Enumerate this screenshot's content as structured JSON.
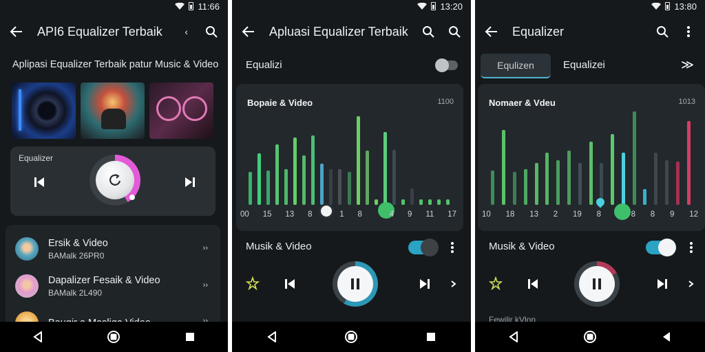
{
  "panel1": {
    "status_time": "11:66",
    "title": "API6 Equalizer Terbaik",
    "title_suffix": "‹",
    "subtitle": "Aplipasi Equalizer Terbaik patur Music & Video",
    "eq_card_label": "Equalizer",
    "list": [
      {
        "title": "Ersik & Video",
        "sub": "BAMalk 26PR0"
      },
      {
        "title": "Dapalizer Fesaik & Video",
        "sub": "BAMalk 2L490"
      },
      {
        "title": "Bougir a Masliga Video",
        "sub": ""
      }
    ],
    "list_arrow": "››"
  },
  "panel2": {
    "status_time": "13:20",
    "title": "Apluasi Equalizer Terbaik",
    "toggle_label": "Equalizi",
    "eq_title": "Bopaie & Video",
    "eq_value": "1100",
    "ticks": [
      "00",
      "15",
      "13",
      "8",
      "",
      "1",
      "8",
      "",
      "4",
      "9",
      "11",
      "17"
    ],
    "bars": [
      {
        "h": 0.35,
        "c": "#39b36a"
      },
      {
        "h": 0.55,
        "c": "#3fcf7c"
      },
      {
        "h": 0.37,
        "c": "#3aa66a"
      },
      {
        "h": 0.65,
        "c": "#57c46f"
      },
      {
        "h": 0.38,
        "c": "#4fb86c"
      },
      {
        "h": 0.72,
        "c": "#63cf69"
      },
      {
        "h": 0.53,
        "c": "#57b86a"
      },
      {
        "h": 0.74,
        "c": "#4bbf77"
      },
      {
        "h": 0.44,
        "c": "#4aa3c8"
      },
      {
        "h": 0.38,
        "c": "#384046"
      },
      {
        "h": 0.38,
        "c": "#4a5056"
      },
      {
        "h": 0.35,
        "c": "#3a7a55"
      },
      {
        "h": 0.95,
        "c": "#6ccf63"
      },
      {
        "h": 0.58,
        "c": "#5ea862"
      },
      {
        "h": 0.06,
        "c": "#6ccf63"
      },
      {
        "h": 0.78,
        "c": "#5ccd7e"
      },
      {
        "h": 0.59,
        "c": "#3b4a55"
      },
      {
        "h": 0.06,
        "c": "#52c46a"
      },
      {
        "h": 0.18,
        "c": "#3a4046"
      },
      {
        "h": 0.06,
        "c": "#52c46a"
      },
      {
        "h": 0.06,
        "c": "#52c46a"
      },
      {
        "h": 0.06,
        "c": "#52c46a"
      },
      {
        "h": 0.06,
        "c": "#52c46a"
      }
    ],
    "track_label": "Musik & Video"
  },
  "panel3": {
    "status_time": "13:80",
    "title": "Equalizer",
    "tab_active": "Equlizen",
    "tab_2": "Equalizei",
    "tab_more": "≫",
    "eq_title": "Nomaer & Vdeu",
    "eq_value": "1013",
    "ticks": [
      "10",
      "18",
      "13",
      "2",
      "19",
      "8",
      "",
      "8",
      "8",
      "9",
      "12"
    ],
    "bars": [
      {
        "h": 0.37,
        "c": "#3c8f55"
      },
      {
        "h": 0.8,
        "c": "#5cc26a"
      },
      {
        "h": 0.35,
        "c": "#3d7e56"
      },
      {
        "h": 0.38,
        "c": "#4eaa62"
      },
      {
        "h": 0.45,
        "c": "#5ab865"
      },
      {
        "h": 0.56,
        "c": "#56b565"
      },
      {
        "h": 0.48,
        "c": "#4aa05c"
      },
      {
        "h": 0.58,
        "c": "#4e9b5d"
      },
      {
        "h": 0.45,
        "c": "#40505a"
      },
      {
        "h": 0.68,
        "c": "#5bbf6a"
      },
      {
        "h": 0.45,
        "c": "#3c4a52"
      },
      {
        "h": 0.76,
        "c": "#5cc86a"
      },
      {
        "h": 0.56,
        "c": "#4ad0e0"
      },
      {
        "h": 1.0,
        "c": "#3f8b55"
      },
      {
        "h": 0.17,
        "c": "#38b2c7"
      },
      {
        "h": 0.56,
        "c": "#3e4850"
      },
      {
        "h": 0.48,
        "c": "#3e4850"
      },
      {
        "h": 0.46,
        "c": "#a43150"
      },
      {
        "h": 0.9,
        "c": "#d63e62"
      }
    ],
    "track_label": "Musik & Video",
    "bottom_text": "Fewilir kVlon"
  }
}
